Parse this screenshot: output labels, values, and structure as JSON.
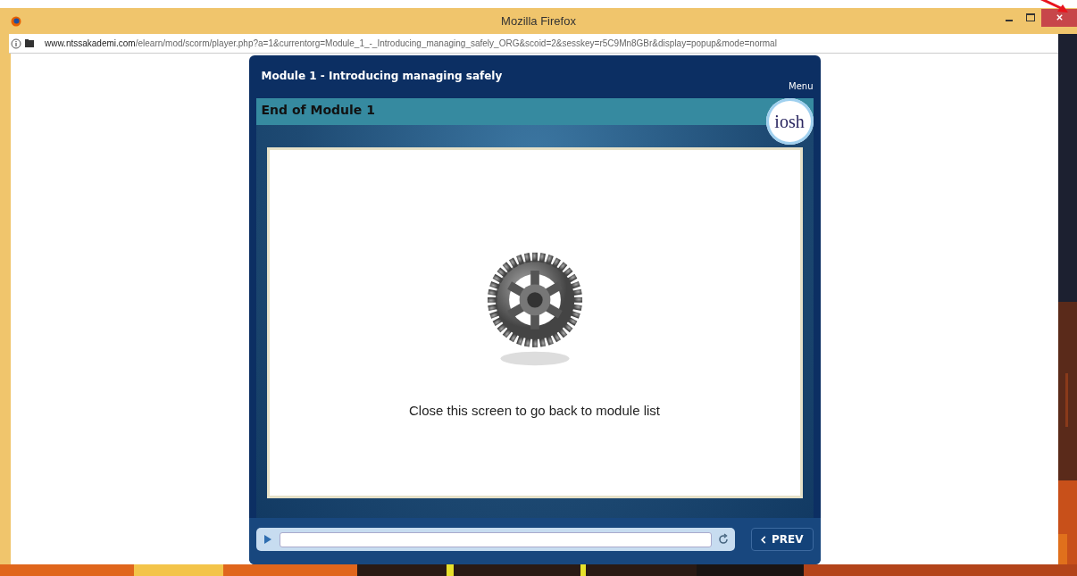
{
  "window": {
    "title": "Mozilla Firefox",
    "url_domain": "www.ntssakademi.com",
    "url_path": "/elearn/mod/scorm/player.php?a=1&currentorg=Module_1_-_Introducing_managing_safely_ORG&scoid=2&sesskey=r5C9Mn8GBr&display=popup&mode=normal"
  },
  "player": {
    "title": "Module 1 - Introducing managing safely",
    "menu": "Menu",
    "section": "End of Module 1",
    "logo": "iosh",
    "message": "Close this screen to go back to module list",
    "progress": {
      "level": 0
    },
    "prev": "PREV"
  }
}
